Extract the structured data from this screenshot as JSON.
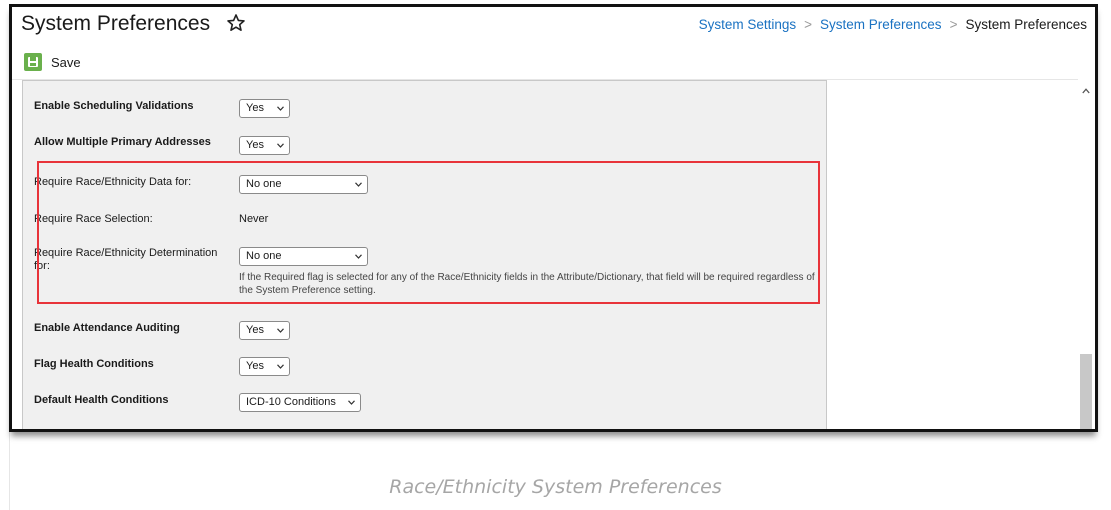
{
  "header": {
    "title": "System Preferences",
    "breadcrumb": [
      "System Settings",
      "System Preferences",
      "System Preferences"
    ]
  },
  "toolbar": {
    "save_label": "Save"
  },
  "settings": [
    {
      "label": "Enable Scheduling Validations",
      "value": "Yes"
    },
    {
      "label": "Allow Multiple Primary Addresses",
      "value": "Yes"
    },
    {
      "label": "Require Race/Ethnicity Data for:",
      "value": "No one"
    },
    {
      "label": "Require Race Selection:",
      "value": "Never"
    },
    {
      "label": "Require Race/Ethnicity Determination for:",
      "value": "No one"
    },
    {
      "label": "Enable Attendance Auditing",
      "value": "Yes"
    },
    {
      "label": "Flag Health Conditions",
      "value": "Yes"
    },
    {
      "label": "Default Health Conditions",
      "value": "ICD-10 Conditions"
    }
  ],
  "help_text": "If the Required flag is selected for any of the Race/Ethnicity fields in the Attribute/Dictionary, that field will be required regardless of the System Preference setting.",
  "caption": "Race/Ethnicity System Preferences",
  "colors": {
    "accent": "#1a72c2",
    "highlight": "#e8333a",
    "save_icon": "#6ab04c"
  },
  "icons": [
    "star-icon",
    "save-icon",
    "chevron-down-icon",
    "chevron-up-icon"
  ]
}
